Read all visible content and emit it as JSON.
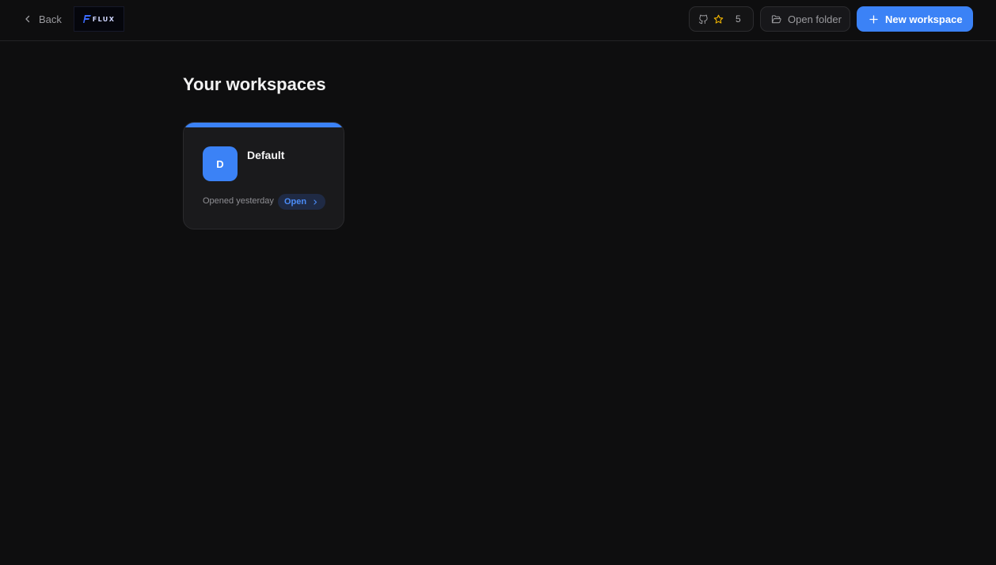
{
  "header": {
    "back_label": "Back",
    "logo_text": "FLUX",
    "star_count": "5",
    "open_folder_label": "Open folder",
    "new_workspace_label": "New workspace"
  },
  "main": {
    "title": "Your workspaces",
    "workspaces": [
      {
        "initial": "D",
        "name": "Default",
        "last_opened": "Opened yesterday",
        "open_label": "Open"
      }
    ]
  },
  "colors": {
    "background": "#0e0e0f",
    "accent": "#3b82f6",
    "card": "#1a1a1c",
    "star": "#f0b400"
  },
  "icons": [
    "chevron-left-icon",
    "github-icon",
    "star-icon",
    "folder-open-icon",
    "plus-icon",
    "chevron-right-icon"
  ]
}
